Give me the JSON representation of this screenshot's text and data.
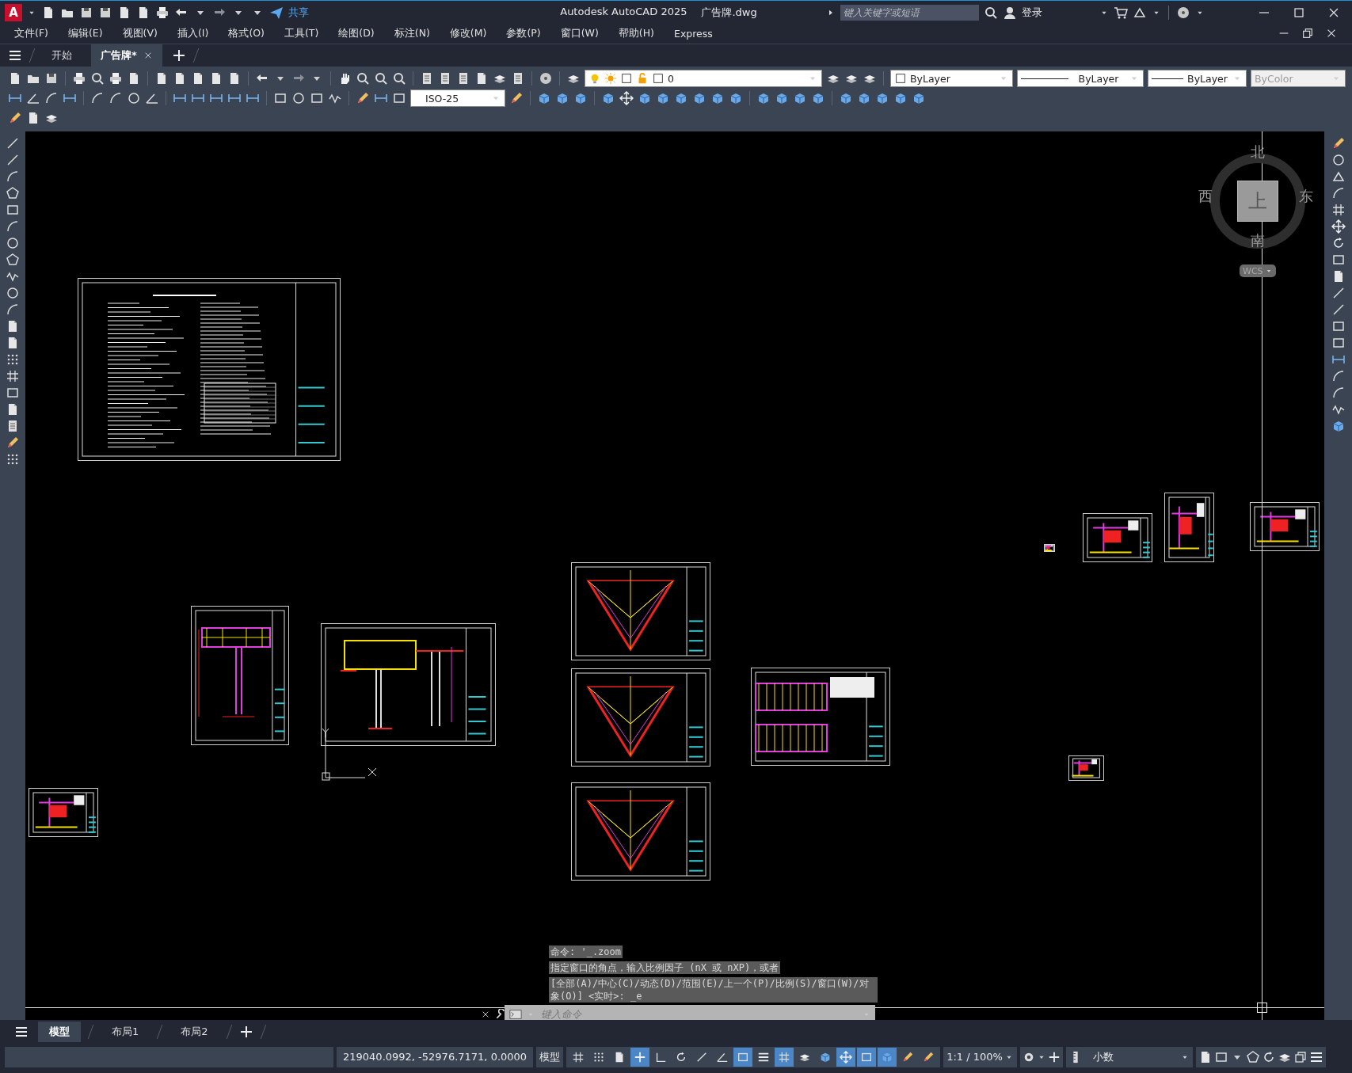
{
  "title_bar": {
    "logo": "A",
    "share": "共享",
    "app_title": "Autodesk AutoCAD 2025",
    "file_name": "广告牌.dwg",
    "search": {
      "placeholder": "键入关键字或短语"
    },
    "login": "登录"
  },
  "menu": [
    "文件(F)",
    "编辑(E)",
    "视图(V)",
    "插入(I)",
    "格式(O)",
    "工具(T)",
    "绘图(D)",
    "标注(N)",
    "修改(M)",
    "参数(P)",
    "窗口(W)",
    "帮助(H)",
    "Express"
  ],
  "doc_tabs": [
    {
      "label": "开始",
      "selected": false
    },
    {
      "label": "广告牌*",
      "selected": true
    }
  ],
  "toolbar": {
    "layer": "0",
    "text_style": "ISO-25",
    "color_setting": "ByLayer",
    "linetype": "ByLayer",
    "lineweight": "ByLayer",
    "plot_style": {
      "value": "ByColor",
      "disabled": true
    }
  },
  "viewcube": {
    "north": "北",
    "south": "南",
    "east": "东",
    "west": "西",
    "face": "上",
    "ucs": "WCS"
  },
  "command_history": [
    "命令: '_.zoom",
    "指定窗口的角点，输入比例因子 (nX 或 nXP)，或者",
    "[全部(A)/中心(C)/动态(D)/范围(E)/上一个(P)/比例(S)/窗口(W)/对象(O)] <实时>: _e"
  ],
  "command_input": {
    "placeholder": "键入命令"
  },
  "layout_tabs": [
    {
      "label": "模型",
      "selected": true
    },
    {
      "label": "布局1",
      "selected": false
    },
    {
      "label": "布局2",
      "selected": false
    }
  ],
  "status_bar": {
    "coordinates": "219040.0992, -52976.7171, 0.0000",
    "space": "模型",
    "toggles": [
      {
        "on": false
      },
      {
        "on": false
      },
      {
        "on": false
      },
      {
        "on": true
      },
      {
        "on": false
      },
      {
        "on": false
      },
      {
        "on": false
      },
      {
        "on": false
      },
      {
        "on": true
      },
      {
        "on": false
      },
      {
        "on": true
      },
      {
        "on": false
      },
      {
        "on": false
      },
      {
        "on": true
      },
      {
        "on": true
      },
      {
        "on": true
      },
      {
        "on": false
      },
      {
        "on": false
      }
    ],
    "scale": "1:1 / 100%",
    "units": "小数"
  }
}
